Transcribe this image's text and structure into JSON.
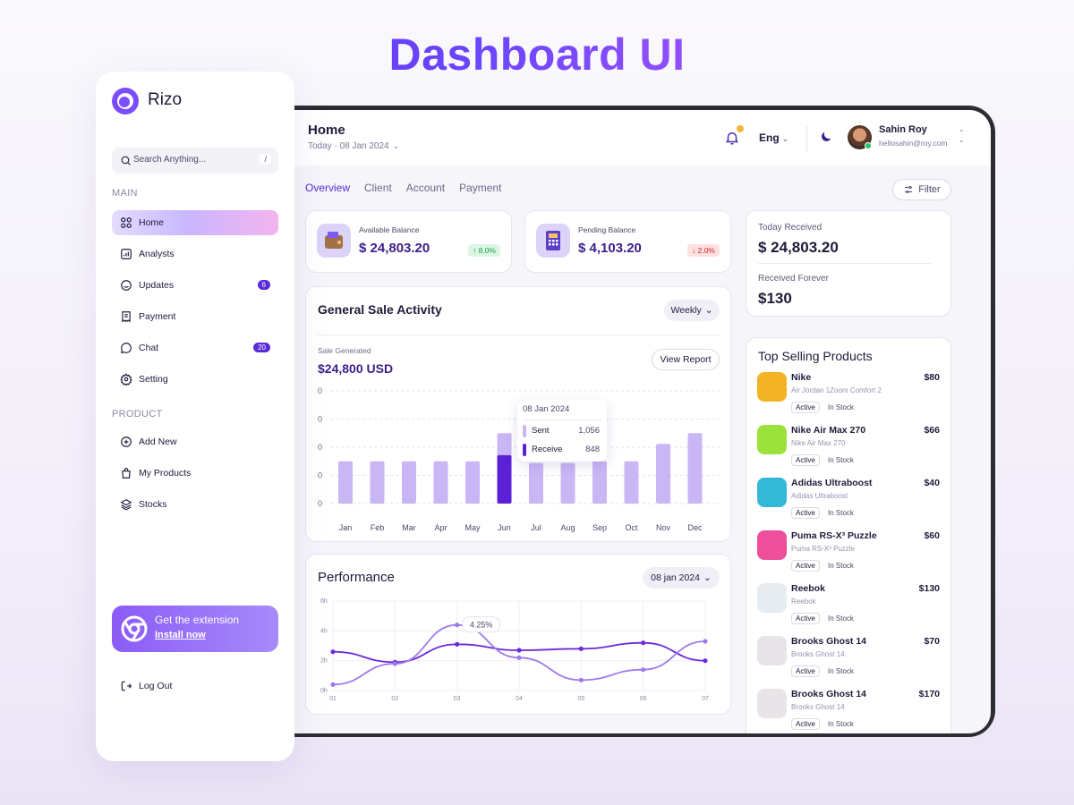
{
  "hero": {
    "title": "Dashboard UI"
  },
  "sidebar": {
    "brand": "Rizo",
    "search_placeholder": "Search Anything...",
    "search_shortcut": "/",
    "group_main": "MAIN",
    "group_product": "PRODUCT",
    "main_items": [
      {
        "label": "Home",
        "icon": "grid-icon",
        "active": true
      },
      {
        "label": "Analysts",
        "icon": "chart-icon"
      },
      {
        "label": "Updates",
        "icon": "smile-icon",
        "count": "6"
      },
      {
        "label": "Payment",
        "icon": "receipt-icon"
      },
      {
        "label": "Chat",
        "icon": "chat-icon",
        "count": "20"
      },
      {
        "label": "Setting",
        "icon": "gear-icon"
      }
    ],
    "product_items": [
      {
        "label": "Add New",
        "icon": "plus-circle-icon"
      },
      {
        "label": "My Products",
        "icon": "bag-icon"
      },
      {
        "label": "Stocks",
        "icon": "layers-icon"
      }
    ],
    "extension": {
      "title": "Get the extension",
      "link": "Install now"
    },
    "logout": "Log Out"
  },
  "header": {
    "title": "Home",
    "date": "Today · 08 Jan 2024",
    "language": "Eng",
    "user": {
      "name": "Sahin Roy",
      "email": "hellosahin@roy.com"
    }
  },
  "tabs": [
    "Overview",
    "Client",
    "Account",
    "Payment"
  ],
  "filter_label": "Filter",
  "balances": {
    "available": {
      "label": "Available Balance",
      "value": "$ 24,803.20",
      "change": "↑ 8.0%"
    },
    "pending": {
      "label": "Pending Balance",
      "value": "$ 4,103.20",
      "change": "↓ 2.0%"
    }
  },
  "received": {
    "today_label": "Today Received",
    "today_value": "$ 24,803.20",
    "forever_label": "Received Forever",
    "forever_value": "$130"
  },
  "sale_activity": {
    "title": "General Sale Activity",
    "period": "Weekly",
    "generated_label": "Sale Generated",
    "generated_value": "$24,800 USD",
    "view_report": "View Report",
    "tooltip": {
      "date": "08 Jan 2024",
      "sent_label": "Sent",
      "sent_value": "1,056",
      "receive_label": "Receive",
      "receive_value": "848"
    }
  },
  "performance": {
    "title": "Performance",
    "date": "08 jan 2024",
    "tooltip": "4.25%"
  },
  "top_selling": {
    "title": "Top Selling Products",
    "items": [
      {
        "name": "Nike",
        "sub": "Air Jordan 1Zoom Comfort 2",
        "price": "$80",
        "status": "Active",
        "stock": "In Stock",
        "color": "#f2b324"
      },
      {
        "name": "Nike Air Max 270",
        "sub": "Nike Air Max 270",
        "price": "$66",
        "status": "Active",
        "stock": "In Stock",
        "color": "#9be23c"
      },
      {
        "name": "Adidas Ultraboost",
        "sub": "Adidas Ultraboost",
        "price": "$40",
        "status": "Active",
        "stock": "In Stock",
        "color": "#33b8d8"
      },
      {
        "name": "Puma RS-X³ Puzzle",
        "sub": "Puma RS-X³ Puzzle",
        "price": "$60",
        "status": "Active",
        "stock": "In Stock",
        "color": "#ee4f9a"
      },
      {
        "name": "Reebok",
        "sub": "Reebok",
        "price": "$130",
        "status": "Active",
        "stock": "In Stock",
        "color": "#e6ecef"
      },
      {
        "name": "Brooks Ghost 14",
        "sub": "Brooks Ghost 14",
        "price": "$70",
        "status": "Active",
        "stock": "In Stock",
        "color": "#e8e4e8"
      },
      {
        "name": "Brooks Ghost 14",
        "sub": "Brooks Ghost 14",
        "price": "$170",
        "status": "Active",
        "stock": "In Stock",
        "color": "#e8e4e8"
      }
    ]
  },
  "chart_data": [
    {
      "type": "bar",
      "title": "General Sale Activity",
      "categories": [
        "Jan",
        "Feb",
        "Mar",
        "Apr",
        "May",
        "Jun",
        "Jul",
        "Aug",
        "Sep",
        "Oct",
        "Nov",
        "Dec"
      ],
      "y_tick_labels": [
        "0",
        "0",
        "0",
        "0",
        "0"
      ],
      "series": [
        {
          "name": "Sent",
          "values": [
            0.375,
            0.375,
            0.375,
            0.375,
            0.375,
            0.625,
            0.36,
            0.36,
            0.375,
            0.375,
            0.53,
            0.625
          ]
        },
        {
          "name": "Receive",
          "values": [
            0,
            0,
            0,
            0,
            0,
            0.43,
            0,
            0,
            0,
            0,
            0,
            0
          ]
        }
      ],
      "highlight_category": "Jun",
      "colors": {
        "bar": "#c9b6f5",
        "highlight": "#5b21d6"
      },
      "grid": true
    },
    {
      "type": "line",
      "title": "Performance",
      "x": [
        "01",
        "02",
        "03",
        "04",
        "05",
        "06",
        "07"
      ],
      "y_tick_labels": [
        "0h",
        "2h",
        "4h",
        "6h"
      ],
      "ylim": [
        0,
        6
      ],
      "series": [
        {
          "values": [
            2.6,
            1.9,
            3.1,
            2.7,
            2.8,
            3.2,
            2.0
          ],
          "color": "#6d28d9"
        },
        {
          "values": [
            0.4,
            1.8,
            4.4,
            2.2,
            0.7,
            1.4,
            3.3
          ],
          "color": "#9f7aea"
        }
      ],
      "annotation": {
        "x": "03",
        "label": "4.25%"
      },
      "grid": true
    }
  ],
  "colors": {
    "accent": "#5b2bd8",
    "positive": "#16a34a",
    "negative": "#dc2626"
  }
}
